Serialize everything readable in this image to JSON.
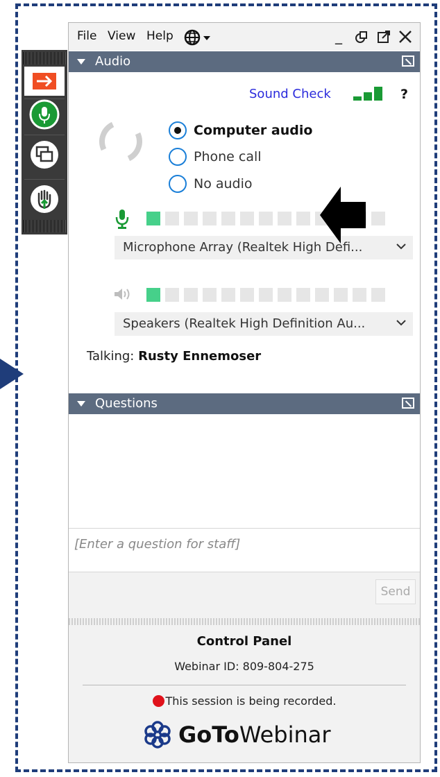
{
  "menu": {
    "file": "File",
    "view": "View",
    "help": "Help"
  },
  "audio": {
    "section_title": "Audio",
    "sound_check": "Sound Check",
    "help": "?",
    "options": [
      "Computer audio",
      "Phone call",
      "No audio"
    ],
    "selected_option": "Computer audio",
    "microphone_device": "Microphone Array (Realtek High Defi...",
    "speaker_device": "Speakers (Realtek High Definition Au...",
    "talking_label": "Talking:",
    "talking_name": "Rusty Ennemoser"
  },
  "questions": {
    "section_title": "Questions",
    "placeholder": "[Enter a question for staff]",
    "send": "Send"
  },
  "control_panel": {
    "title": "Control Panel",
    "webinar_id": "Webinar ID: 809-804-275",
    "recording": "This session is being recorded.",
    "brand_goto": "GoTo",
    "brand_webinar": "Webinar"
  },
  "colors": {
    "accent_blue": "#1f3d7a",
    "header": "#5c6b80",
    "mic_green": "#1a9a35",
    "level_on": "#46d08a",
    "recording_red": "#e0121b",
    "toolbar_orange": "#f04e23"
  }
}
